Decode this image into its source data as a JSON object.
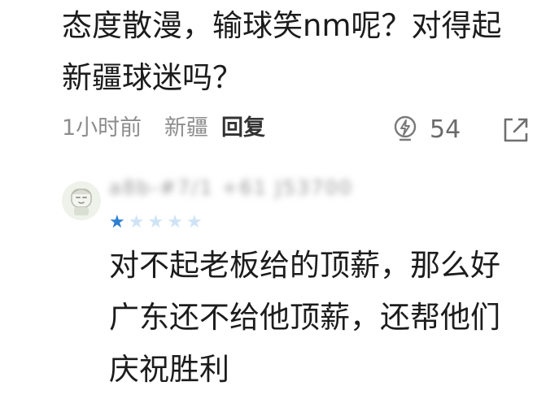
{
  "comment": {
    "text": "态度散漫，输球笑nm呢？对得起新疆球迷吗？",
    "time": "1小时前",
    "location": "新疆",
    "reply_label": "回复",
    "like_count": "54"
  },
  "reply": {
    "username": "a8b-#7/1 +61 J53700",
    "rating": 1,
    "rating_max": 5,
    "text": "对不起老板给的顶薪，那么好广东还不给他顶薪，还帮他们庆祝胜利"
  },
  "colors": {
    "text": "#1c1c1c",
    "meta": "#8d8d8d",
    "star_filled": "#2d7fd0",
    "star_empty": "#cfe3f6"
  },
  "icons": {
    "like": "lightbulb-icon",
    "share": "share-icon",
    "avatar": "avatar-face-icon"
  }
}
